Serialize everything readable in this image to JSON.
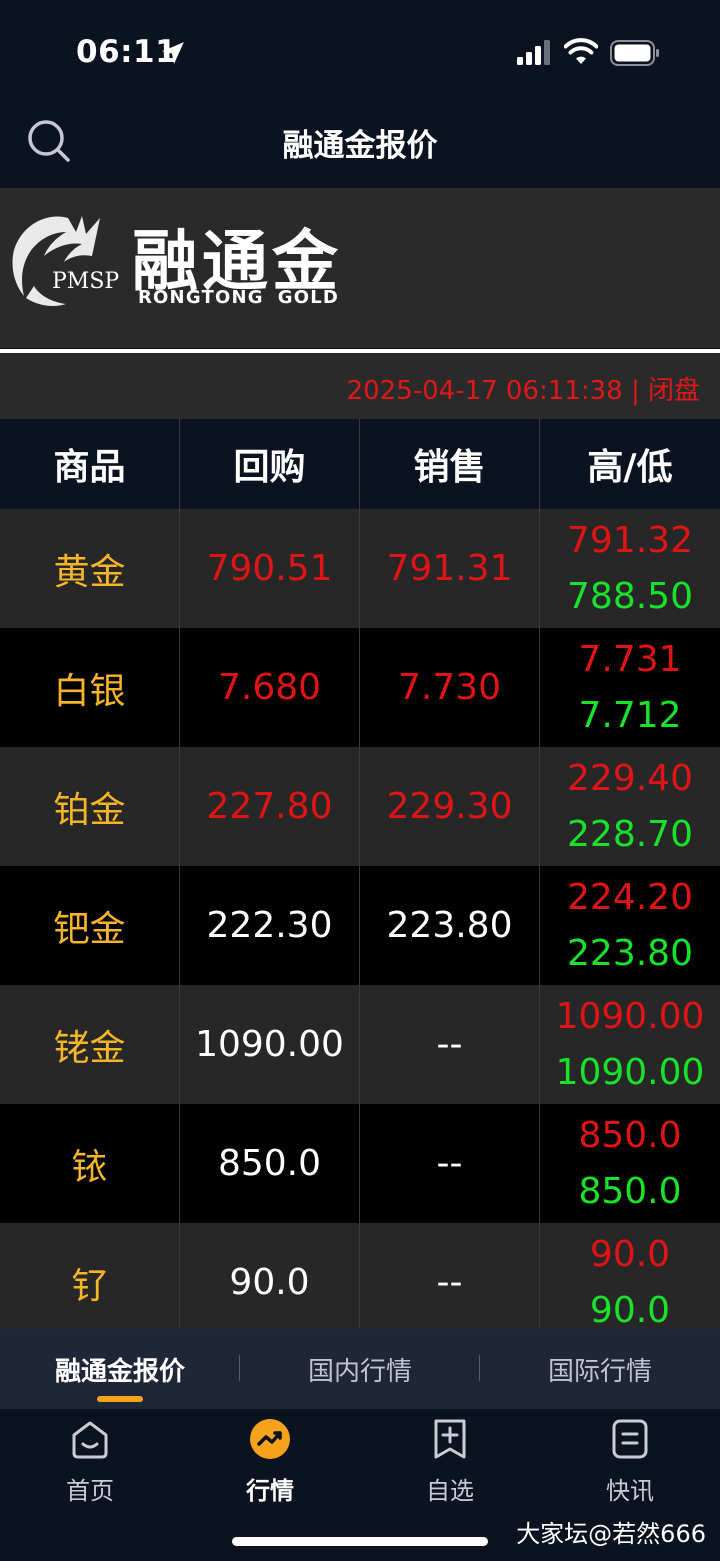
{
  "status_bar": {
    "time": "06:11"
  },
  "header": {
    "title": "融通金报价"
  },
  "brand": {
    "name_zh": "融通金",
    "badge": "PMSP",
    "name_en_1": "RONGTONG",
    "name_en_2": "GOLD"
  },
  "info": {
    "timestamp": "2025-04-17 06:11:38 | 闭盘"
  },
  "table": {
    "columns": [
      "商品",
      "回购",
      "销售",
      "高/低"
    ],
    "rows": [
      {
        "name": "黄金",
        "buy": "790.51",
        "sell": "791.31",
        "high": "791.32",
        "low": "788.50",
        "price_color": "red"
      },
      {
        "name": "白银",
        "buy": "7.680",
        "sell": "7.730",
        "high": "7.731",
        "low": "7.712",
        "price_color": "red"
      },
      {
        "name": "铂金",
        "buy": "227.80",
        "sell": "229.30",
        "high": "229.40",
        "low": "228.70",
        "price_color": "red"
      },
      {
        "name": "钯金",
        "buy": "222.30",
        "sell": "223.80",
        "high": "224.20",
        "low": "223.80",
        "price_color": "white"
      },
      {
        "name": "铑金",
        "buy": "1090.00",
        "sell": "--",
        "high": "1090.00",
        "low": "1090.00",
        "price_color": "white"
      },
      {
        "name": "铱",
        "buy": "850.0",
        "sell": "--",
        "high": "850.0",
        "low": "850.0",
        "price_color": "white"
      },
      {
        "name": "钌",
        "buy": "90.0",
        "sell": "--",
        "high": "90.0",
        "low": "90.0",
        "price_color": "white"
      }
    ]
  },
  "sub_tabs": [
    {
      "label": "融通金报价",
      "active": true
    },
    {
      "label": "国内行情",
      "active": false
    },
    {
      "label": "国际行情",
      "active": false
    }
  ],
  "tab_bar": [
    {
      "label": "首页",
      "icon": "home-icon",
      "active": false
    },
    {
      "label": "行情",
      "icon": "market-trend-icon",
      "active": true
    },
    {
      "label": "自选",
      "icon": "add-favorite-icon",
      "active": false
    },
    {
      "label": "快讯",
      "icon": "news-icon",
      "active": false
    }
  ],
  "watermark": "大家坛@若然666",
  "colors": {
    "accent": "#f7a21b",
    "up": "#e01414",
    "down": "#19e22b",
    "commodity": "#f7b528"
  }
}
